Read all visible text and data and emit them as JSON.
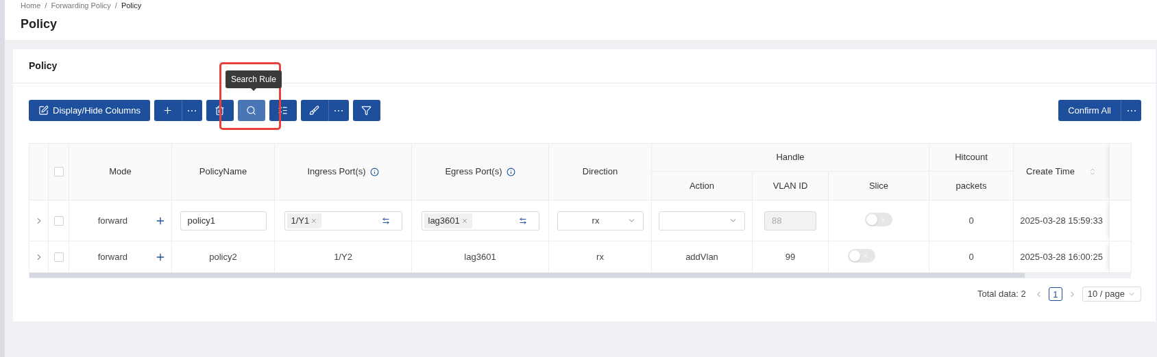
{
  "breadcrumb": {
    "items": [
      "Home",
      "Forwarding Policy",
      "Policy"
    ],
    "separator": "/"
  },
  "page_title": "Policy",
  "card": {
    "title": "Policy",
    "toolbar": {
      "left": [
        [
          {
            "kind": "columns",
            "label": "Display/Hide Columns"
          }
        ],
        [
          {
            "kind": "add"
          },
          {
            "kind": "more"
          }
        ],
        [
          {
            "kind": "delete"
          }
        ],
        [
          {
            "kind": "search",
            "hovered": true,
            "tooltip": "Search Rule",
            "highlighted": true
          }
        ],
        [
          {
            "kind": "list"
          }
        ],
        [
          {
            "kind": "clean"
          },
          {
            "kind": "more"
          }
        ],
        [
          {
            "kind": "filter"
          }
        ]
      ],
      "right": [
        [
          {
            "kind": "text",
            "label": "Confirm All"
          },
          {
            "kind": "more"
          }
        ]
      ]
    },
    "table": {
      "select_all": {
        "checked": false
      },
      "columns": [
        {
          "label": "Mode"
        },
        {
          "label": "PolicyName"
        },
        {
          "label": "Ingress Port(s)",
          "info": true
        },
        {
          "label": "Egress Port(s)",
          "info": true
        },
        {
          "label": "Direction"
        },
        {
          "label": "Handle",
          "children": [
            {
              "label": "Action"
            },
            {
              "label": "VLAN ID"
            },
            {
              "label": "Slice"
            }
          ]
        },
        {
          "label": "Hitcount",
          "children": [
            {
              "label": "packets"
            }
          ]
        },
        {
          "label": "Create Time",
          "sortable": true
        }
      ],
      "rows": [
        {
          "editing": true,
          "checked": false,
          "mode": "forward",
          "policy_name": "policy1",
          "ingress": [
            "1/Y1"
          ],
          "egress": [
            "lag3601"
          ],
          "direction": "rx",
          "vlan_id": "88",
          "vlan_disabled": true,
          "slice_on": false,
          "hitcount": "0",
          "create_time": "2025-03-28 15:59:33"
        },
        {
          "editing": false,
          "checked": false,
          "mode": "forward",
          "policy_name": "policy2",
          "ingress": [
            "1/Y2"
          ],
          "egress": [
            "lag3601"
          ],
          "direction": "rx",
          "action": "addVlan",
          "vlan_id": "99",
          "slice_on": false,
          "hitcount": "0",
          "create_time": "2025-03-28 16:00:25"
        }
      ]
    },
    "pagination": {
      "total": "Total data: 2",
      "pages": [
        {
          "label": "1",
          "selected": true
        }
      ],
      "page_size": "10 / page"
    }
  }
}
